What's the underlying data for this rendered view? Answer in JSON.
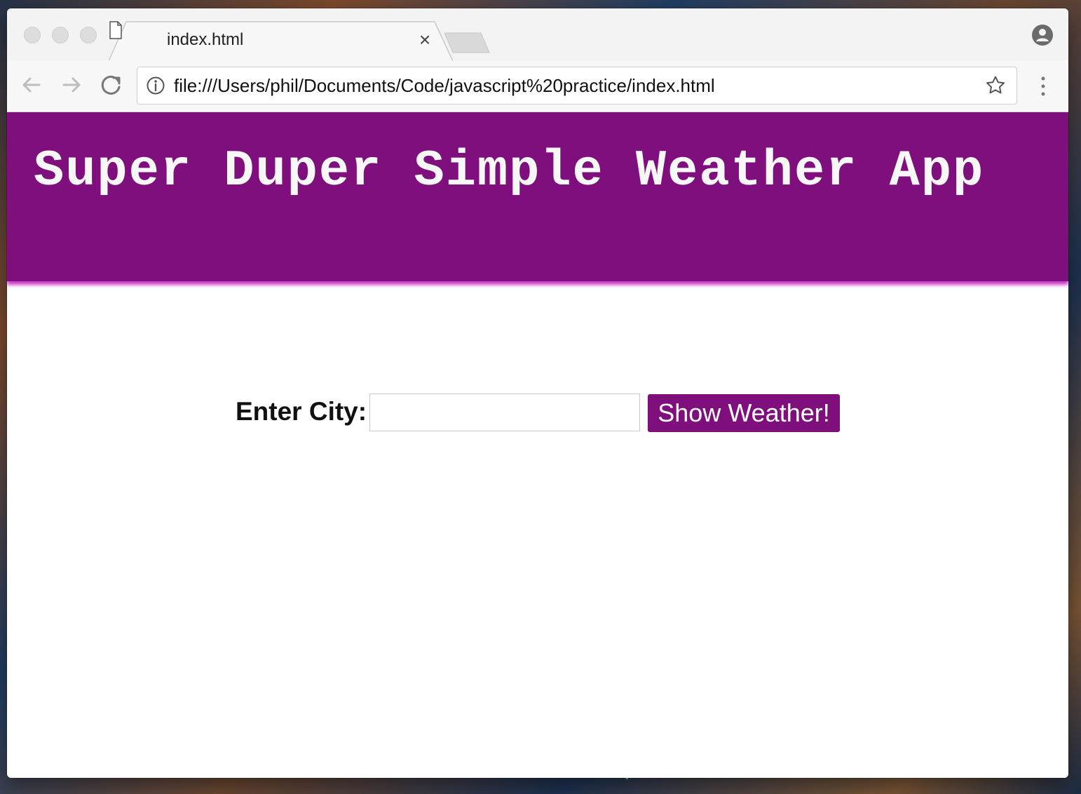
{
  "browser": {
    "tab": {
      "title": "index.html",
      "close_glyph": "×",
      "page_icon": "document-icon"
    },
    "toolbar": {
      "back_icon": "back-arrow-icon",
      "forward_icon": "forward-arrow-icon",
      "reload_icon": "reload-icon",
      "info_icon": "info-icon",
      "star_icon": "star-icon",
      "menu_icon": "vertical-dots-icon",
      "url": "file:///Users/phil/Documents/Code/javascript%20practice/index.html"
    },
    "profile_icon": "profile-icon"
  },
  "app": {
    "title": "Super Duper Simple Weather App",
    "form": {
      "label": "Enter City:",
      "input_value": "",
      "input_placeholder": "",
      "button_label": "Show Weather!"
    }
  },
  "colors": {
    "header_background": "#7f0f7c",
    "header_glow": "#c42ac4",
    "button_background": "#7f0f7c",
    "header_text": "#f7f7f7",
    "page_background": "#ffffff"
  }
}
